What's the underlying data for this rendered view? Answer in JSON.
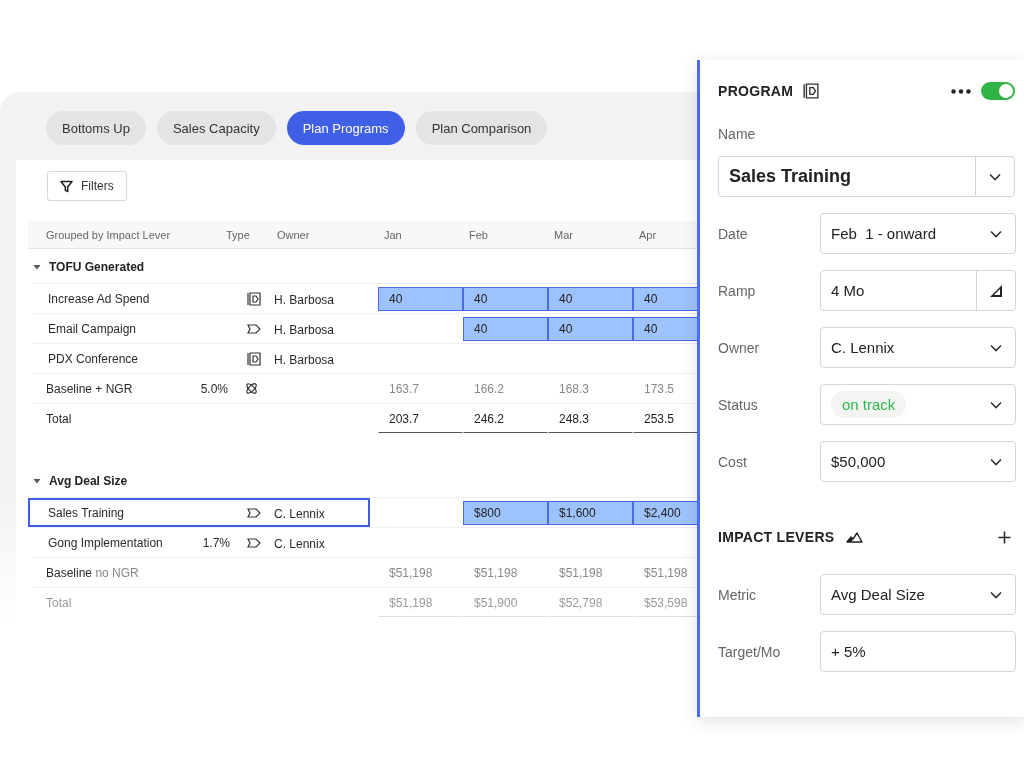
{
  "tabs": [
    {
      "label": "Bottoms Up",
      "selected": false
    },
    {
      "label": "Sales Capacity",
      "selected": false
    },
    {
      "label": "Plan Programs",
      "selected": true
    },
    {
      "label": "Plan Comparison",
      "selected": false
    }
  ],
  "filters_button": {
    "label": "Filters"
  },
  "table": {
    "columns": [
      "Grouped by Impact Lever",
      "Type",
      "Owner",
      "Jan",
      "Feb",
      "Mar",
      "Apr"
    ],
    "groups": [
      {
        "name": "TOFU Generated",
        "expanded": true,
        "rows": [
          {
            "kind": "program",
            "name": "Increase Ad Spend",
            "type": {
              "kind": "campaign"
            },
            "owner": "H. Barbosa",
            "selected": false,
            "cells": [
              {
                "text": "40",
                "highlighted": true
              },
              {
                "text": "40",
                "highlighted": true
              },
              {
                "text": "40",
                "highlighted": true
              },
              {
                "text": "40",
                "highlighted": true
              }
            ]
          },
          {
            "kind": "program",
            "name": "Email Campaign",
            "type": {
              "kind": "tag"
            },
            "owner": "H. Barbosa",
            "selected": false,
            "cells": [
              null,
              {
                "text": "40",
                "highlighted": true
              },
              {
                "text": "40",
                "highlighted": true
              },
              {
                "text": "40",
                "highlighted": true
              }
            ]
          },
          {
            "kind": "program",
            "name": "PDX Conference",
            "type": {
              "kind": "campaign"
            },
            "owner": "H. Barbosa",
            "selected": false,
            "cells": [
              null,
              null,
              null,
              null
            ]
          },
          {
            "kind": "baseline",
            "name": "Baseline + NGR",
            "percent": "5.0%",
            "type": {
              "kind": "atom"
            },
            "cells": [
              {
                "text": "163.7",
                "highlighted": false
              },
              {
                "text": "166.2",
                "highlighted": false
              },
              {
                "text": "168.3",
                "highlighted": false
              },
              {
                "text": "173.5",
                "highlighted": false
              }
            ]
          },
          {
            "kind": "total",
            "name": "Total",
            "muted": false,
            "cells": [
              {
                "text": "203.7",
                "highlighted": false
              },
              {
                "text": "246.2",
                "highlighted": false
              },
              {
                "text": "248.3",
                "highlighted": false
              },
              {
                "text": "253.5",
                "highlighted": false
              }
            ]
          }
        ]
      },
      {
        "name": "Avg Deal Size",
        "expanded": true,
        "rows": [
          {
            "kind": "program",
            "name": "Sales Training",
            "type": {
              "kind": "tag"
            },
            "owner": "C. Lennix",
            "selected": true,
            "cells": [
              null,
              {
                "text": "$800",
                "highlighted": true
              },
              {
                "text": "$1,600",
                "highlighted": true
              },
              {
                "text": "$2,400",
                "highlighted": true
              }
            ]
          },
          {
            "kind": "program",
            "name": "Gong Implementation",
            "percent": "1.7%",
            "type": {
              "kind": "tag"
            },
            "owner": "C. Lennix",
            "selected": false,
            "cells": [
              null,
              null,
              null,
              null
            ]
          },
          {
            "kind": "baseline",
            "name": "Baseline",
            "note": "no NGR",
            "cells": [
              {
                "text": "$51,198",
                "highlighted": false
              },
              {
                "text": "$51,198",
                "highlighted": false
              },
              {
                "text": "$51,198",
                "highlighted": false
              },
              {
                "text": "$51,198",
                "highlighted": false
              }
            ]
          },
          {
            "kind": "total",
            "name": "Total",
            "muted": true,
            "cells": [
              {
                "text": "$51,198",
                "highlighted": false
              },
              {
                "text": "$51,900",
                "highlighted": false
              },
              {
                "text": "$52,798",
                "highlighted": false
              },
              {
                "text": "$53,598",
                "highlighted": false
              }
            ]
          }
        ]
      }
    ]
  },
  "panel": {
    "title": "PROGRAM",
    "enabled": true,
    "name_label": "Name",
    "name_value": "Sales Training",
    "fields": [
      {
        "label": "Date",
        "kind": "select",
        "value": "Feb  1 - onward"
      },
      {
        "label": "Ramp",
        "kind": "ramp",
        "value": "4 Mo"
      },
      {
        "label": "Owner",
        "kind": "select",
        "value": "C. Lennix"
      },
      {
        "label": "Status",
        "kind": "status",
        "value": "on track",
        "color": "#2db84d"
      },
      {
        "label": "Cost",
        "kind": "select",
        "value": "$50,000"
      }
    ],
    "section_title": "IMPACT LEVERS",
    "lever_fields": [
      {
        "label": "Metric",
        "kind": "select",
        "value": "Avg Deal Size"
      },
      {
        "label": "Target/Mo",
        "kind": "input",
        "value": "+ 5%"
      }
    ]
  }
}
